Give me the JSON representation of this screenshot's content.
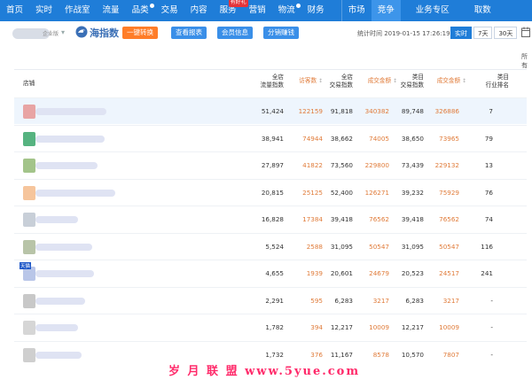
{
  "nav": {
    "items": [
      {
        "label": "首页",
        "active": false,
        "dot": false,
        "badge": ""
      },
      {
        "label": "实时",
        "active": false,
        "dot": false,
        "badge": ""
      },
      {
        "label": "作战室",
        "active": false,
        "dot": false,
        "badge": ""
      },
      {
        "label": "流量",
        "active": false,
        "dot": false,
        "badge": ""
      },
      {
        "label": "品类",
        "active": false,
        "dot": true,
        "badge": ""
      },
      {
        "label": "交易",
        "active": false,
        "dot": false,
        "badge": ""
      },
      {
        "label": "内容",
        "active": false,
        "dot": false,
        "badge": ""
      },
      {
        "label": "服务",
        "active": false,
        "dot": false,
        "badge": "有好礼"
      },
      {
        "label": "营销",
        "active": false,
        "dot": false,
        "badge": ""
      },
      {
        "label": "物流",
        "active": false,
        "dot": true,
        "badge": ""
      },
      {
        "label": "财务",
        "active": false,
        "dot": false,
        "badge": ""
      },
      {
        "label": "市场",
        "active": false,
        "dot": false,
        "badge": ""
      },
      {
        "label": "竞争",
        "active": true,
        "dot": false,
        "badge": ""
      },
      {
        "label": "业务专区",
        "active": false,
        "dot": false,
        "badge": ""
      },
      {
        "label": "取数",
        "active": false,
        "dot": false,
        "badge": ""
      }
    ]
  },
  "toolbar": {
    "store_suffix": "企业版",
    "logo_text": "海指数",
    "buttons": [
      "一键转换",
      "查看报表",
      "会员信息",
      "分销赚钱"
    ],
    "stat_time_label": "统计时间 2019-01-15 17:26:19",
    "ranges": [
      "实时",
      "7天",
      "30天"
    ],
    "all_label": "所有"
  },
  "table": {
    "headers": {
      "store": "店铺",
      "traffic_index": [
        "全店",
        "流量指数"
      ],
      "visitors": "访客数",
      "trade_index": [
        "全店",
        "交易指数"
      ],
      "turnover": "成交金额",
      "cat_trade_index": [
        "类目",
        "交易指数"
      ],
      "cat_turnover": "成交金额",
      "rank": [
        "类目",
        "行业排名"
      ]
    },
    "rows": [
      {
        "traffic_index": "51,424",
        "visitors": "122159",
        "trade_index": "91,818",
        "turnover": "340382",
        "cat_trade_index": "89,748",
        "cat_turnover": "326886",
        "rank": "7",
        "mall_tag": ""
      },
      {
        "traffic_index": "38,941",
        "visitors": "74944",
        "trade_index": "38,662",
        "turnover": "74005",
        "cat_trade_index": "38,650",
        "cat_turnover": "73965",
        "rank": "79",
        "mall_tag": ""
      },
      {
        "traffic_index": "27,897",
        "visitors": "41822",
        "trade_index": "73,560",
        "turnover": "229800",
        "cat_trade_index": "73,439",
        "cat_turnover": "229132",
        "rank": "13",
        "mall_tag": ""
      },
      {
        "traffic_index": "20,815",
        "visitors": "25125",
        "trade_index": "52,400",
        "turnover": "126271",
        "cat_trade_index": "39,232",
        "cat_turnover": "75929",
        "rank": "76",
        "mall_tag": ""
      },
      {
        "traffic_index": "16,828",
        "visitors": "17384",
        "trade_index": "39,418",
        "turnover": "76562",
        "cat_trade_index": "39,418",
        "cat_turnover": "76562",
        "rank": "74",
        "mall_tag": ""
      },
      {
        "traffic_index": "5,524",
        "visitors": "2588",
        "trade_index": "31,095",
        "turnover": "50547",
        "cat_trade_index": "31,095",
        "cat_turnover": "50547",
        "rank": "116",
        "mall_tag": ""
      },
      {
        "traffic_index": "4,655",
        "visitors": "1939",
        "trade_index": "20,601",
        "turnover": "24679",
        "cat_trade_index": "20,523",
        "cat_turnover": "24517",
        "rank": "241",
        "mall_tag": "天猫"
      },
      {
        "traffic_index": "2,291",
        "visitors": "595",
        "trade_index": "6,283",
        "turnover": "3217",
        "cat_trade_index": "6,283",
        "cat_turnover": "3217",
        "rank": "-",
        "mall_tag": ""
      },
      {
        "traffic_index": "1,782",
        "visitors": "394",
        "trade_index": "12,217",
        "turnover": "10009",
        "cat_trade_index": "12,217",
        "cat_turnover": "10009",
        "rank": "-",
        "mall_tag": ""
      },
      {
        "traffic_index": "1,732",
        "visitors": "376",
        "trade_index": "11,167",
        "turnover": "8578",
        "cat_trade_index": "10,570",
        "cat_turnover": "7807",
        "rank": "-",
        "mall_tag": ""
      }
    ]
  },
  "watermark": "岁 月 联 盟  www.5yue.com",
  "colors": {
    "nav_bg": "#1f7dd8",
    "nav_active": "#3d95ea",
    "accent_orange": "#e07b39",
    "btn_orange": "#ff7d28",
    "btn_blue": "#3a8fe8",
    "row_highlight": "#eef5fd",
    "watermark": "#ff2a6a"
  },
  "icons": {
    "logo": "dolphin-logo-icon",
    "calendar": "calendar-icon",
    "chevron": "chevron-down-icon"
  }
}
